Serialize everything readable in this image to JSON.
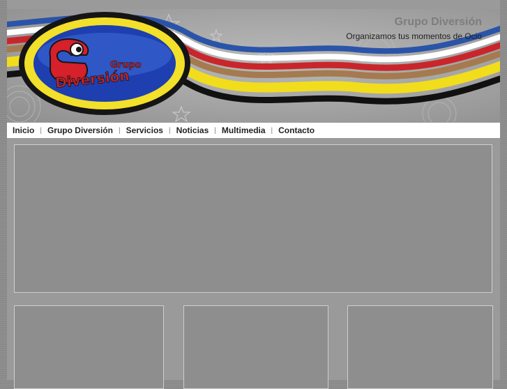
{
  "header": {
    "title": "Grupo Diversión",
    "tagline": "Organizamos tus momentos de Ocio",
    "logo": {
      "word_top": "Grupo",
      "word_bottom": "Diversión",
      "colors": {
        "oval_blue": "#1e3fb0",
        "yellow": "#f2e02a",
        "red": "#c52329",
        "mascot_body": "#d6202a"
      }
    },
    "wave_colors": [
      "#2a54a8",
      "#ffffff",
      "#c9262b",
      "#a57a4e",
      "#f1dd1c",
      "#111111"
    ]
  },
  "nav": {
    "items": [
      {
        "label": "Inicio"
      },
      {
        "label": "Grupo Diversión"
      },
      {
        "label": "Servicios"
      },
      {
        "label": "Noticias"
      },
      {
        "label": "Multimedia"
      },
      {
        "label": "Contacto"
      }
    ],
    "separator": "|"
  }
}
